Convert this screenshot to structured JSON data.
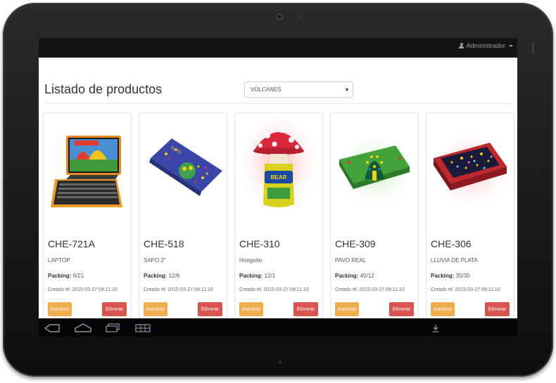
{
  "header": {
    "user_label": "Administrador"
  },
  "page": {
    "title": "Listado de productos",
    "category_selected": "VOLCANES"
  },
  "products": [
    {
      "code": "CHE-721A",
      "name": "LAPTOP",
      "packing_label": "Packing:",
      "packing": "6/21",
      "created": "Creado el: 2015-03-27 09:11:10",
      "inactivate": "Inactivar",
      "delete": "Eliminar"
    },
    {
      "code": "CHE-518",
      "name": "SAPO 2\"",
      "packing_label": "Packing:",
      "packing": "12/6",
      "created": "Creado el: 2015-03-27 09:11:10",
      "inactivate": "Inactivar",
      "delete": "Eliminar"
    },
    {
      "code": "CHE-310",
      "name": "Honguito",
      "packing_label": "Packing:",
      "packing": "12/1",
      "created": "Creado el: 2015-03-27 09:11:10",
      "inactivate": "Inactivar",
      "delete": "Eliminar"
    },
    {
      "code": "CHE-309",
      "name": "PAVO REAL",
      "packing_label": "Packing:",
      "packing": "40/12",
      "created": "Creado el: 2015-03-27 09:11:10",
      "inactivate": "Inactivar",
      "delete": "Eliminar"
    },
    {
      "code": "CHE-306",
      "name": "LLUVIA DE PLATA",
      "packing_label": "Packing:",
      "packing": "30/30",
      "created": "Creado el: 2015-03-27 09:11:10",
      "inactivate": "Inactivar",
      "delete": "Eliminar"
    }
  ],
  "colors": {
    "warning": "#f0ad4e",
    "danger": "#d9534f",
    "topbar": "#141414"
  },
  "icons": [
    "back-icon",
    "home-icon",
    "recent-apps-icon",
    "grid-icon",
    "download-icon",
    "user-icon",
    "caret-down-icon"
  ]
}
